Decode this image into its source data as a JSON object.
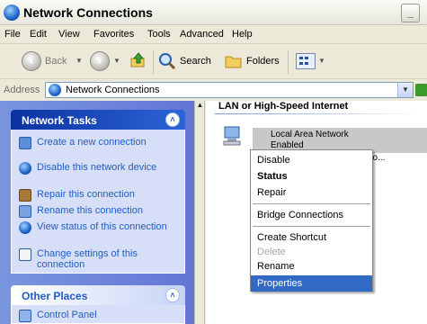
{
  "window": {
    "title": "Network Connections"
  },
  "menu": [
    "File",
    "Edit",
    "View",
    "Favorites",
    "Tools",
    "Advanced",
    "Help"
  ],
  "toolbar": {
    "back": "Back",
    "search": "Search",
    "folders": "Folders"
  },
  "address": {
    "label": "Address",
    "value": "Network Connections"
  },
  "network_tasks": {
    "title": "Network Tasks",
    "items": [
      {
        "label": "Create a new connection",
        "icon": "new-connection-icon"
      },
      {
        "label": "Disable this network device",
        "icon": "disable-device-icon"
      },
      {
        "label": "Repair this connection",
        "icon": "repair-icon"
      },
      {
        "label": "Rename this connection",
        "icon": "rename-icon"
      },
      {
        "label": "View status of this connection",
        "icon": "status-icon"
      },
      {
        "label": "Change settings of this connection",
        "icon": "settings-icon"
      }
    ]
  },
  "other_places": {
    "title": "Other Places",
    "items": [
      {
        "label": "Control Panel",
        "icon": "control-panel-icon"
      }
    ]
  },
  "content": {
    "group": "LAN or High-Speed Internet",
    "connection": {
      "name": "Local Area Network",
      "status": "Enabled",
      "device": "PCI Fo..."
    }
  },
  "context_menu": {
    "items": [
      "Disable",
      "Status",
      "Repair",
      "Bridge Connections",
      "Create Shortcut",
      "Delete",
      "Rename",
      "Properties"
    ],
    "default_item": "Status",
    "disabled_item": "Delete",
    "selected_item": "Properties"
  },
  "colors": {
    "taskpane": "#6375d6",
    "link": "#215dc6",
    "menu_highlight": "#316ac5"
  }
}
